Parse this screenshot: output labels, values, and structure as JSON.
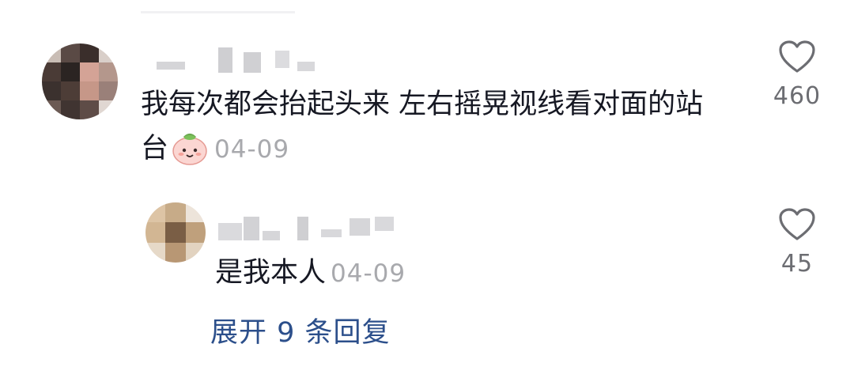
{
  "comment": {
    "text": "我每次都会抬起头来 左右摇晃视线看对面的站台",
    "emoji": "peach-face-emoji",
    "date": "04-09",
    "likes": "460"
  },
  "reply": {
    "text": "是我本人",
    "date": "04-09",
    "likes": "45"
  },
  "expand_replies_label": "展开 9 条回复",
  "colors": {
    "text": "#161823",
    "secondary": "#a8a9ad",
    "like_count": "#6c6d72",
    "link": "#2c4f8b"
  },
  "icons": [
    "heart-outline-icon",
    "peach-face-emoji"
  ]
}
